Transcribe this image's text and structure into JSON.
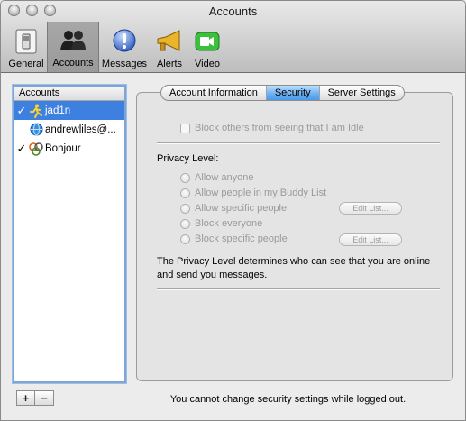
{
  "window": {
    "title": "Accounts"
  },
  "toolbar": {
    "items": [
      {
        "label": "General",
        "icon": "general-switch-icon"
      },
      {
        "label": "Accounts",
        "icon": "accounts-people-icon",
        "selected": true
      },
      {
        "label": "Messages",
        "icon": "messages-bubble-icon"
      },
      {
        "label": "Alerts",
        "icon": "alerts-megaphone-icon"
      },
      {
        "label": "Video",
        "icon": "video-camera-icon"
      }
    ]
  },
  "accounts": {
    "header": "Accounts",
    "items": [
      {
        "name": "jad1n",
        "checked": true,
        "icon": "aim-running-man-icon",
        "selected": true
      },
      {
        "name": "andrewliles@...",
        "checked": false,
        "icon": "mac-globe-icon",
        "selected": false
      },
      {
        "name": "Bonjour",
        "checked": true,
        "icon": "bonjour-icon",
        "selected": false
      }
    ],
    "add_label": "+",
    "remove_label": "−"
  },
  "tabs": {
    "items": [
      {
        "label": "Account Information",
        "active": false
      },
      {
        "label": "Security",
        "active": true
      },
      {
        "label": "Server Settings",
        "active": false
      }
    ]
  },
  "security": {
    "idle_checkbox_label": "Block others from seeing that I am Idle",
    "privacy_level_label": "Privacy Level:",
    "options": [
      "Allow anyone",
      "Allow people in my Buddy List",
      "Allow specific people",
      "Block everyone",
      "Block specific people"
    ],
    "edit_list_label": "Edit List...",
    "description": "The Privacy Level determines who can see that you are online and send you messages."
  },
  "footer": {
    "message": "You cannot change security settings while logged out."
  },
  "colors": {
    "selection": "#3d80df",
    "tab_active": "#6fb2f2",
    "disabled_text": "#9a9a9a"
  }
}
